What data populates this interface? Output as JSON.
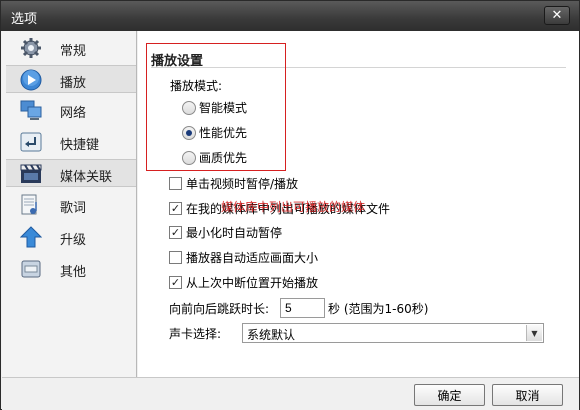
{
  "window": {
    "title": "选项",
    "close_glyph": "✕"
  },
  "sidebar": {
    "items": [
      {
        "label": "常规",
        "icon": "gear-icon"
      },
      {
        "label": "播放",
        "icon": "play-icon"
      },
      {
        "label": "网络",
        "icon": "network-icon"
      },
      {
        "label": "快捷键",
        "icon": "shortcut-icon"
      },
      {
        "label": "媒体关联",
        "icon": "film-icon"
      },
      {
        "label": "歌词",
        "icon": "lyrics-icon"
      },
      {
        "label": "升级",
        "icon": "upgrade-icon"
      },
      {
        "label": "其他",
        "icon": "other-icon"
      }
    ],
    "active_index": 1
  },
  "playback": {
    "section_title": "播放设置",
    "mode_label": "播放模式:",
    "modes": [
      {
        "label": "智能模式",
        "checked": false
      },
      {
        "label": "性能优先",
        "checked": true
      },
      {
        "label": "画质优先",
        "checked": false
      }
    ],
    "options": [
      {
        "label": "单击视频时暂停/播放",
        "checked": false
      },
      {
        "label": "在我的媒体库中列出可播放的媒体文件",
        "checked": true
      },
      {
        "label": "最小化时自动暂停",
        "checked": true
      },
      {
        "label": "播放器自动适应画面大小",
        "checked": false
      },
      {
        "label": "从上次中断位置开始播放",
        "checked": true
      }
    ],
    "overlay_text": "媒体库中列出可播放的媒体",
    "skip_label": "向前向后跳跃时长:",
    "skip_value": "5",
    "skip_unit": "秒 (范围为1-60秒)",
    "soundcard_label": "声卡选择:",
    "soundcard_value": "系统默认"
  },
  "footer": {
    "ok_label": "确定",
    "cancel_label": "取消"
  },
  "colors": {
    "highlight_border": "#d62020",
    "titlebar": "#3a3a3a"
  }
}
